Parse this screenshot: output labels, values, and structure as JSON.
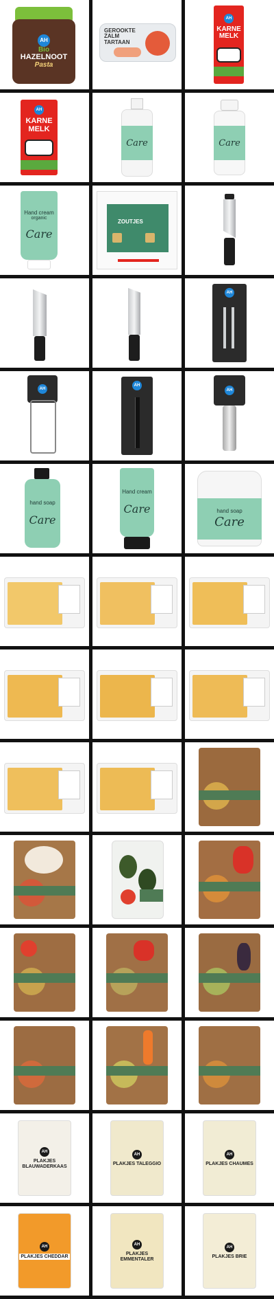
{
  "grid": {
    "columns": 3
  },
  "texts": {
    "hazelnoot_brand": "Bio",
    "hazelnoot_name": "HAZELNOOT",
    "hazelnoot_sub": "Pasta",
    "zalm": "GEROOKTE ZALM TARTAAN",
    "karne1": "KARNE MELK",
    "karne2": "KARNE MELK",
    "care": "Care",
    "handcream": "Hand cream",
    "organic": "organic",
    "soup_box": "ZOUTJES",
    "handsoap": "hand soap",
    "cheese_bluewhite": "PLAKJES BLAUWADERKAAS",
    "cheese_taleggio": "PLAKJES TALEGGIO",
    "cheese_chaumes": "PLAKJES CHAUMES",
    "cheese_cheddar": "PLAKJES CHEDDAR",
    "cheese_emmentaler": "PLAKJES EMMENTALER",
    "cheese_brie": "PLAKJES BRIE",
    "ah": "AH"
  },
  "colors": {
    "care_green": "#8ecfb3",
    "ah_blue": "#1e86d8",
    "karne_red": "#e3251f",
    "cheese_slice": "#f2c86a",
    "cheddar": "#f29a2a"
  },
  "tiles": [
    {
      "name": "hazelnut-paste-jar"
    },
    {
      "name": "smoked-salmon-tartare"
    },
    {
      "name": "buttermilk-carton-1"
    },
    {
      "name": "buttermilk-carton-2"
    },
    {
      "name": "care-pump-bottle"
    },
    {
      "name": "care-flip-bottle"
    },
    {
      "name": "care-hand-cream-tube"
    },
    {
      "name": "snack-box-dieline"
    },
    {
      "name": "chef-knife-packaged-1"
    },
    {
      "name": "chef-knife-2"
    },
    {
      "name": "chef-knife-3"
    },
    {
      "name": "peeler-set-packaged"
    },
    {
      "name": "julienne-peeler"
    },
    {
      "name": "sharpening-steel"
    },
    {
      "name": "corkscrew"
    },
    {
      "name": "care-hand-soap-pump"
    },
    {
      "name": "care-hand-cream-tube-2"
    },
    {
      "name": "care-hand-soap-refill"
    },
    {
      "name": "cheese-slices-1"
    },
    {
      "name": "cheese-slices-2"
    },
    {
      "name": "cheese-slices-3"
    },
    {
      "name": "cheese-slices-4"
    },
    {
      "name": "cheese-slices-5"
    },
    {
      "name": "cheese-slices-6"
    },
    {
      "name": "cheese-slices-7"
    },
    {
      "name": "cheese-slices-8"
    },
    {
      "name": "meal-kit-1"
    },
    {
      "name": "meal-kit-2"
    },
    {
      "name": "avocado-tomato-pack"
    },
    {
      "name": "meal-kit-3"
    },
    {
      "name": "meal-kit-4"
    },
    {
      "name": "meal-kit-5"
    },
    {
      "name": "meal-kit-6"
    },
    {
      "name": "meal-kit-7"
    },
    {
      "name": "meal-kit-8"
    },
    {
      "name": "meal-kit-9"
    },
    {
      "name": "cheese-blauwaderkaas"
    },
    {
      "name": "cheese-taleggio"
    },
    {
      "name": "cheese-chaumes"
    },
    {
      "name": "cheese-cheddar"
    },
    {
      "name": "cheese-emmentaler"
    },
    {
      "name": "cheese-brie"
    }
  ]
}
